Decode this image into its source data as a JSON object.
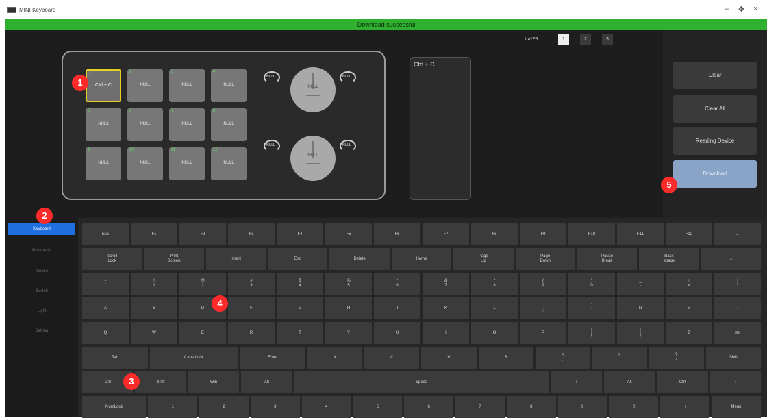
{
  "window": {
    "title": "MINI Keyboard",
    "controls": [
      "–",
      "✥",
      "×"
    ]
  },
  "status": {
    "text": "Download successful"
  },
  "layers": {
    "label": "LAYER",
    "items": [
      "1",
      "2",
      "3"
    ],
    "active": "1"
  },
  "device": {
    "keys": [
      {
        "num": "1",
        "label": "Ctrl + C",
        "selected": true
      },
      {
        "num": "2",
        "label": "NULL"
      },
      {
        "num": "3",
        "label": "NULL"
      },
      {
        "num": "4",
        "label": "NULL"
      },
      {
        "num": "5",
        "label": "NULL"
      },
      {
        "num": "6",
        "label": "NULL"
      },
      {
        "num": "7",
        "label": "NULL"
      },
      {
        "num": "8",
        "label": "NULL"
      },
      {
        "num": "9",
        "label": "NULL"
      },
      {
        "num": "10",
        "label": "NULL"
      },
      {
        "num": "11",
        "label": "NULL"
      },
      {
        "num": "12",
        "label": "NULL"
      }
    ],
    "knobs": [
      {
        "label": "NULL",
        "left": "NULL",
        "right": "NULL"
      },
      {
        "label": "NULL",
        "left": "NULL",
        "right": "NULL"
      }
    ]
  },
  "preview": {
    "text": "Ctrl + C"
  },
  "actions": {
    "clear": "Clear",
    "clear_all": "Clear All",
    "reading": "Reading Device",
    "download": "Download"
  },
  "sidebar": {
    "items": [
      "Keyboard",
      "Multimedia",
      "Mouse",
      "Switch",
      "Light",
      "Setting"
    ],
    "active": 0
  },
  "keyboard": {
    "rows": [
      [
        "Esc",
        "F1",
        "F2",
        "F3",
        "F4",
        "F5",
        "F6",
        "F7",
        "F8",
        "F9",
        "F10",
        "F11",
        "F12",
        "←"
      ],
      [
        "Scroll\nLock",
        "Print\nScreen",
        "Insert",
        "End",
        "Delete",
        "Home",
        "Page\nUp",
        "Page\nDown",
        "Pause\nBreak",
        "Back\nspace",
        "→"
      ],
      [
        "~\n`",
        "!\n1",
        "@\n2",
        "#\n3",
        "$\n4",
        "%\n5",
        "^\n6",
        "&\n7",
        "*\n8",
        "(\n9",
        ")\n0",
        "_\n-",
        "+\n=",
        "|\n\\"
      ],
      [
        "A",
        "S",
        "D",
        "F",
        "G",
        "H",
        "J",
        "K",
        "L",
        ":\n;",
        "\"\n'",
        "N",
        "M",
        "↓"
      ],
      [
        "Q",
        "W",
        "E",
        "R",
        "T",
        "Y",
        "U",
        "I",
        "O",
        "P",
        "{\n[",
        "}\n]",
        "Z",
        "▤"
      ],
      [
        "Tab",
        "Caps Lock",
        "Enter",
        "X",
        "C",
        "V",
        "B",
        "<\n,",
        ">\n.",
        "?\n/",
        "Shift"
      ],
      [
        "Ctrl",
        "Shift",
        "Win",
        "Alt",
        "Space",
        "↑",
        "Alt",
        "Ctrl",
        "↑"
      ],
      [
        "NumLock",
        "1",
        "2",
        "3",
        "4",
        "5",
        "6",
        "7",
        "8",
        "9",
        "0",
        "+",
        "Menu"
      ]
    ]
  },
  "markers": [
    "1",
    "2",
    "3",
    "4",
    "5"
  ]
}
